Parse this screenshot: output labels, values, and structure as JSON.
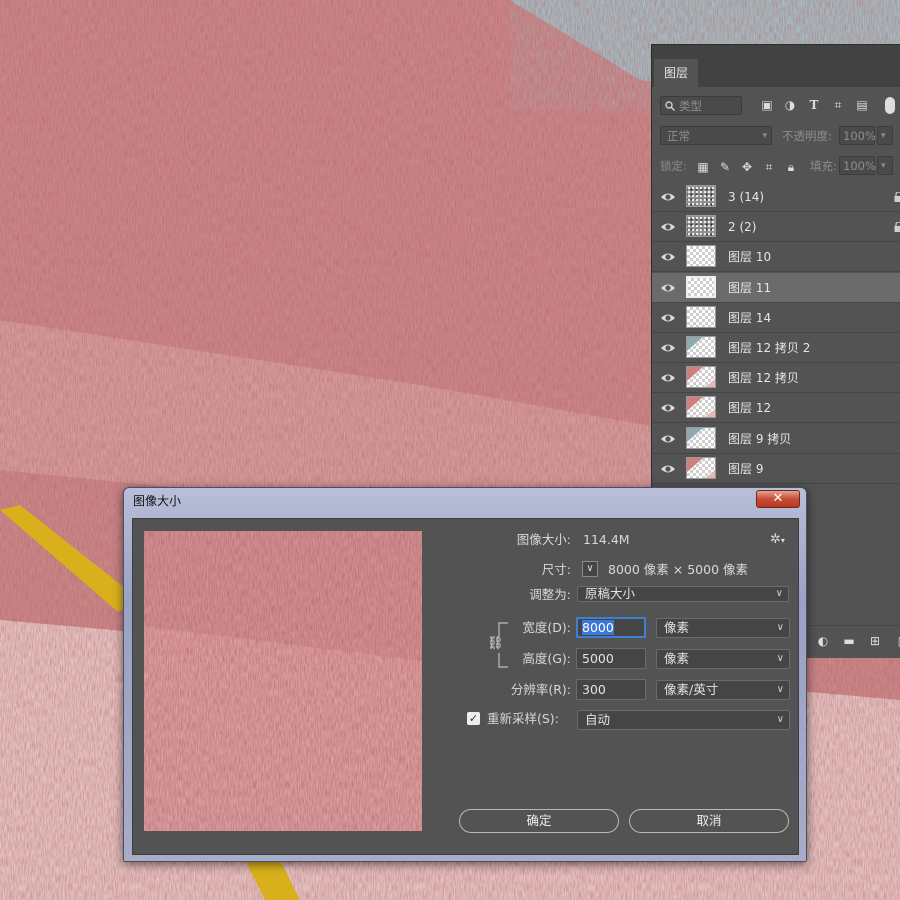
{
  "layers_panel": {
    "tab": "图层",
    "filter_kind": "类型",
    "blend_mode": "正常",
    "opacity_label": "不透明度:",
    "opacity_value": "100%",
    "lock_label": "锁定:",
    "fill_label": "填充:",
    "fill_value": "100%",
    "layers": [
      {
        "name": "3 (14)",
        "thumb": "noise",
        "locked": true,
        "selected": false
      },
      {
        "name": "2 (2)",
        "thumb": "noise",
        "locked": true,
        "selected": false
      },
      {
        "name": "图层 10",
        "thumb": "transparent",
        "locked": false,
        "selected": false
      },
      {
        "name": "图层 11",
        "thumb": "transparent",
        "locked": false,
        "selected": true
      },
      {
        "name": "图层 14",
        "thumb": "transparent",
        "locked": false,
        "selected": false
      },
      {
        "name": "图层 12 拷贝 2",
        "thumb": "teal-corner",
        "locked": false,
        "selected": false
      },
      {
        "name": "图层 12 拷贝",
        "thumb": "red-corner",
        "locked": false,
        "selected": false
      },
      {
        "name": "图层 12",
        "thumb": "red-corner",
        "locked": false,
        "selected": false
      },
      {
        "name": "图层 9 拷贝",
        "thumb": "teal-corner",
        "locked": false,
        "selected": false
      },
      {
        "name": "图层 9",
        "thumb": "red-corner",
        "locked": false,
        "selected": false
      }
    ]
  },
  "dialog": {
    "title": "图像大小",
    "close_label": "✕",
    "image_size_label": "图像大小:",
    "image_size_value": "114.4M",
    "dimensions_label": "尺寸:",
    "dimensions_value": "8000 像素  ×  5000 像素",
    "fit_label": "调整为:",
    "fit_value": "原稿大小",
    "width_label": "宽度(D):",
    "width_value": "8000",
    "width_unit": "像素",
    "height_label": "高度(G):",
    "height_value": "5000",
    "height_unit": "像素",
    "resolution_label": "分辨率(R):",
    "resolution_value": "300",
    "resolution_unit": "像素/英寸",
    "resample_label": "重新采样(S):",
    "resample_checked": true,
    "resample_value": "自动",
    "ok_label": "确定",
    "cancel_label": "取消"
  },
  "colors": {
    "canvas_red": "#c9898a",
    "canvas_pink": "#e2c2bf",
    "canvas_teal": "#9fb4b8",
    "gold": "#d8b21e",
    "panel_bg": "#535353",
    "accent_blue": "#3b78d8",
    "close_red": "#c64d35"
  }
}
